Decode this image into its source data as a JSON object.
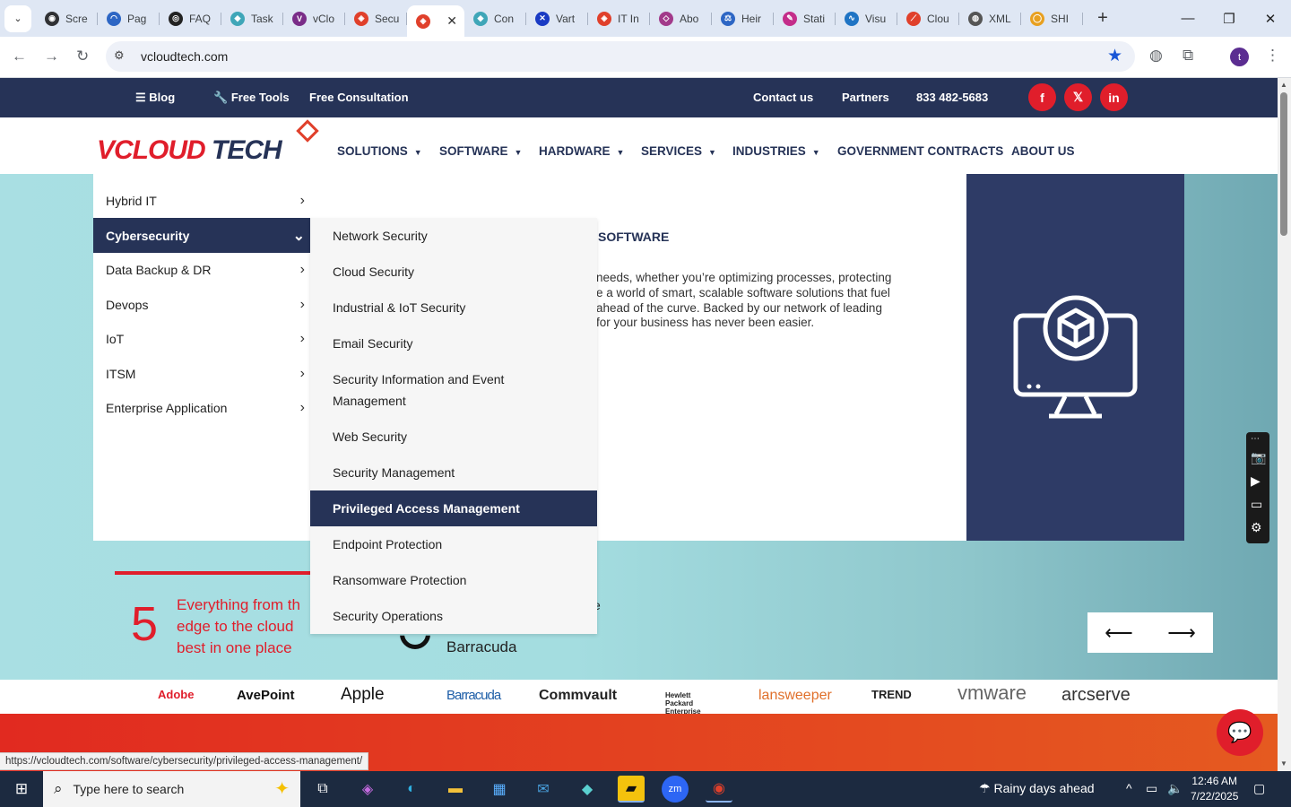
{
  "browser": {
    "tabs": [
      {
        "label": "Scre",
        "fav": "#303134",
        "glyph": "◉"
      },
      {
        "label": "Pag",
        "fav": "#2d66c4",
        "glyph": "◠"
      },
      {
        "label": "FAQ",
        "fav": "#222222",
        "glyph": "◎"
      },
      {
        "label": "Task",
        "fav": "#3fa6b8",
        "glyph": "◆"
      },
      {
        "label": "vClo",
        "fav": "#7a2d88",
        "glyph": "V"
      },
      {
        "label": "Secu",
        "fav": "#e0402b",
        "glyph": "◈"
      },
      {
        "label": "",
        "fav": "#e0402b",
        "glyph": "◈",
        "active": true
      },
      {
        "label": "Con",
        "fav": "#3fa6b8",
        "glyph": "◆"
      },
      {
        "label": "Vart",
        "fav": "#1a3bc4",
        "glyph": "✕"
      },
      {
        "label": "IT In",
        "fav": "#e0402b",
        "glyph": "◈"
      },
      {
        "label": "Abo",
        "fav": "#a23a8a",
        "glyph": "◇"
      },
      {
        "label": "Heir",
        "fav": "#2d66c4",
        "glyph": "⚖"
      },
      {
        "label": "Stati",
        "fav": "#c42d8a",
        "glyph": "✎"
      },
      {
        "label": "Visu",
        "fav": "#1f74c4",
        "glyph": "∿"
      },
      {
        "label": "Clou",
        "fav": "#e0402b",
        "glyph": "⟋"
      },
      {
        "label": "XML",
        "fav": "#555555",
        "glyph": "◍"
      },
      {
        "label": "SHI",
        "fav": "#e8a020",
        "glyph": "◯"
      }
    ],
    "url": "vcloudtech.com",
    "profile_initial": "t"
  },
  "topbar": {
    "blog": "Blog",
    "free_tools": "Free Tools",
    "free_consultation": "Free Consultation",
    "contact": "Contact us",
    "partners": "Partners",
    "phone": "833 482-5683",
    "social": {
      "facebook": "f",
      "x": "𝕏",
      "linkedin": "in"
    }
  },
  "header": {
    "logo_v": "V",
    "logo_cloud": "CLOUD",
    "logo_tech": "TECH",
    "nav": [
      "SOLUTIONS",
      "SOFTWARE",
      "HARDWARE",
      "SERVICES",
      "INDUSTRIES",
      "GOVERNMENT CONTRACTS",
      "ABOUT US"
    ]
  },
  "hero": {
    "title": "SOFTWARE",
    "paragraph_lines": [
      "needs, whether you’re optimizing processes, protecting",
      "e a world of smart, scalable software solutions that fuel",
      "ahead of the curve. Backed by our network of leading",
      "for your business has never been easier."
    ],
    "stat_number": "5",
    "stat_lines": [
      "Everything from th",
      "edge to the cloud",
      "best in one place"
    ],
    "partner_caption": "Barracuda",
    "partial_char": "e"
  },
  "menu_level1": [
    {
      "label": "Hybrid IT",
      "selected": false
    },
    {
      "label": "Cybersecurity",
      "selected": true
    },
    {
      "label": "Data Backup & DR",
      "selected": false
    },
    {
      "label": "Devops",
      "selected": false
    },
    {
      "label": "IoT",
      "selected": false
    },
    {
      "label": "ITSM",
      "selected": false
    },
    {
      "label": "Enterprise Application",
      "selected": false
    }
  ],
  "menu_level2": [
    {
      "label": "Network Security",
      "selected": false
    },
    {
      "label": "Cloud Security",
      "selected": false
    },
    {
      "label": "Industrial & IoT Security",
      "selected": false
    },
    {
      "label": "Email Security",
      "selected": false
    },
    {
      "label": "Security Information and Event Management",
      "selected": false
    },
    {
      "label": "Web Security",
      "selected": false
    },
    {
      "label": "Security Management",
      "selected": false
    },
    {
      "label": "Privileged Access Management",
      "selected": true
    },
    {
      "label": "Endpoint Protection",
      "selected": false
    },
    {
      "label": "Ransomware Protection",
      "selected": false
    },
    {
      "label": "Security Operations",
      "selected": false
    }
  ],
  "brands": [
    {
      "name": "Adobe",
      "color": "#e01e2b"
    },
    {
      "name": "AvePoint",
      "color": "#111111"
    },
    {
      "name": "Apple",
      "color": "#111111"
    },
    {
      "name": "Barracuda",
      "color": "#1f5fa8"
    },
    {
      "name": "Commvault",
      "color": "#222222"
    },
    {
      "name": "Hewlett Packard Enterprise",
      "color": "#222222"
    },
    {
      "name": "lansweeper",
      "color": "#e0702b"
    },
    {
      "name": "TREND",
      "color": "#222222"
    },
    {
      "name": "vmware",
      "color": "#666666"
    },
    {
      "name": "arcserve",
      "color": "#333333"
    }
  ],
  "status_url": "https://vcloudtech.com/software/cybersecurity/privileged-access-management/",
  "taskbar": {
    "search_placeholder": "Type here to search",
    "weather": "Rainy days ahead",
    "time": "12:46 AM",
    "date": "7/22/2025"
  }
}
